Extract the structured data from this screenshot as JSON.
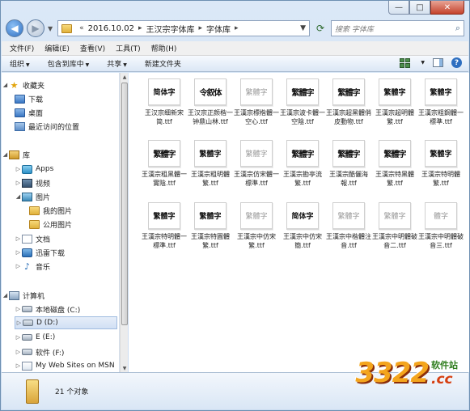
{
  "caption": {
    "minimize": "—",
    "maximize": "□",
    "close": "✕"
  },
  "address": {
    "prefix": "«",
    "segments": [
      "2016.10.02",
      "王汉宗字体库",
      "字体库"
    ],
    "separator": "▸",
    "search_placeholder": "搜索 字体库"
  },
  "menu": [
    "文件(F)",
    "编辑(E)",
    "查看(V)",
    "工具(T)",
    "帮助(H)"
  ],
  "toolbar": [
    "组织",
    "包含到库中",
    "共享",
    "新建文件夹"
  ],
  "nav": {
    "favorites": "收藏夹",
    "favorite_items": [
      "下载",
      "桌面",
      "最近访问的位置"
    ],
    "libraries": "库",
    "library_items": [
      "Apps",
      "视频",
      "图片",
      "我的图片",
      "公用图片",
      "文档",
      "迅雷下载",
      "音乐"
    ],
    "computer": "计算机",
    "drives": [
      "本地磁盘 (C:)",
      "D (D:)",
      "E (E:)",
      "软件 (F:)",
      "My Web Sites on MSN"
    ]
  },
  "files": [
    {
      "name": "王汉宗细新宋简.ttf",
      "preview": "简体字"
    },
    {
      "name": "王汉宗正颜楷一钟鼎山林.ttf",
      "preview": "令叙体"
    },
    {
      "name": "王漢宗標楷體一空心.ttf",
      "preview": "繁體字"
    },
    {
      "name": "王漢宗波卡體一空陰.ttf",
      "preview": "繁體字"
    },
    {
      "name": "王漢宗超黑體俏皮動物.ttf",
      "preview": "繁體字"
    },
    {
      "name": "王漢宗超明體繁.ttf",
      "preview": "繁體字"
    },
    {
      "name": "王漢宗粗鋼體一標準.ttf",
      "preview": "繁體字"
    },
    {
      "name": "王漢宗粗黑體一實陰.ttf",
      "preview": "繁體字"
    },
    {
      "name": "王漢宗粗明體繁.ttf",
      "preview": "繁體字"
    },
    {
      "name": "王漢宗仿宋體一標準.ttf",
      "preview": "繁體字"
    },
    {
      "name": "王漢宗勘亭流繁.ttf",
      "preview": "繁體字"
    },
    {
      "name": "王漢宗酷儷海報.ttf",
      "preview": "繁體字"
    },
    {
      "name": "王漢宗特黑體繁.ttf",
      "preview": "繁體字"
    },
    {
      "name": "王漢宗特明體繁.ttf",
      "preview": "繁體字"
    },
    {
      "name": "王漢宗特明體一標準.ttf",
      "preview": "繁體字"
    },
    {
      "name": "王漢宗特圓體繁.ttf",
      "preview": "繁體字"
    },
    {
      "name": "王漢宗中仿宋繁.ttf",
      "preview": "繁體字"
    },
    {
      "name": "王漢宗中仿宋簡.ttf",
      "preview": "简体字"
    },
    {
      "name": "王漢宗中楷體注音.ttf",
      "preview": "繁體字"
    },
    {
      "name": "王漢宗中明體破音二.ttf",
      "preview": "繁體字"
    },
    {
      "name": "王漢宗中明體破音三.ttf",
      "preview": "體字"
    }
  ],
  "status": {
    "count_text": "21 个对象"
  },
  "watermark": {
    "big": "3322",
    "top": "软件站",
    "cc": ".cc"
  }
}
